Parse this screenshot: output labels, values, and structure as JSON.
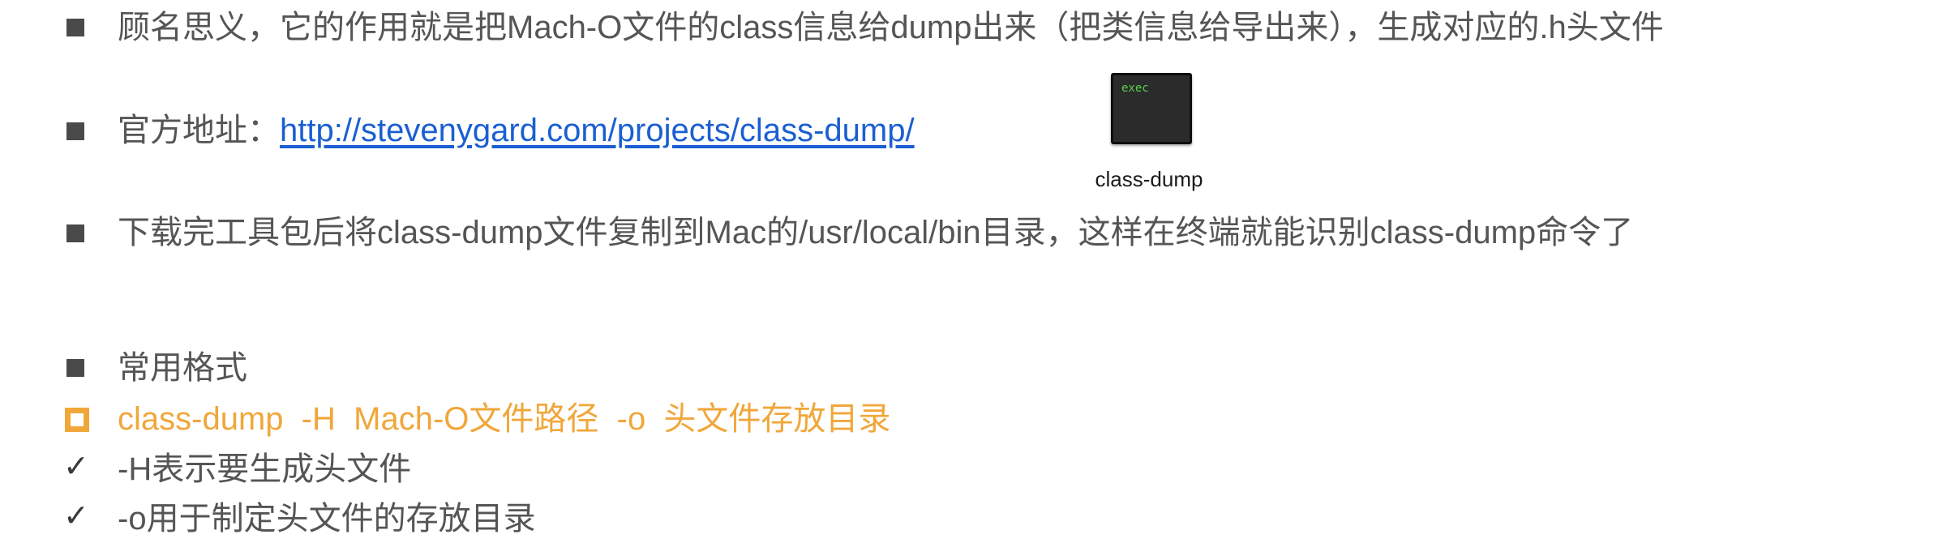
{
  "bullets": [
    {
      "style": "square",
      "text": "顾名思义，它的作用就是把Mach-O文件的class信息给dump出来（把类信息给导出来），生成对应的.h头文件"
    },
    {
      "style": "square",
      "prefix": "官方地址：",
      "link": "http://stevenygard.com/projects/class-dump/"
    },
    {
      "style": "square",
      "text": "下载完工具包后将class-dump文件复制到Mac的/usr/local/bin目录，这样在终端就能识别class-dump命令了"
    },
    {
      "style": "square",
      "text": "常用格式"
    },
    {
      "style": "hollow-square",
      "text": "class-dump  -H  Mach-O文件路径  -o  头文件存放目录"
    },
    {
      "style": "check",
      "text": "-H表示要生成头文件"
    },
    {
      "style": "check",
      "text": "-o用于制定头文件的存放目录"
    }
  ],
  "file_icon": {
    "badge_text": "exec",
    "caption": "class-dump",
    "icon": "terminal-exec-icon"
  },
  "colors": {
    "text": "#555555",
    "bullet": "#4a4a4a",
    "accent_orange": "#f0a73a",
    "link_blue": "#1a5fd1",
    "exec_green": "#5ad14f"
  }
}
